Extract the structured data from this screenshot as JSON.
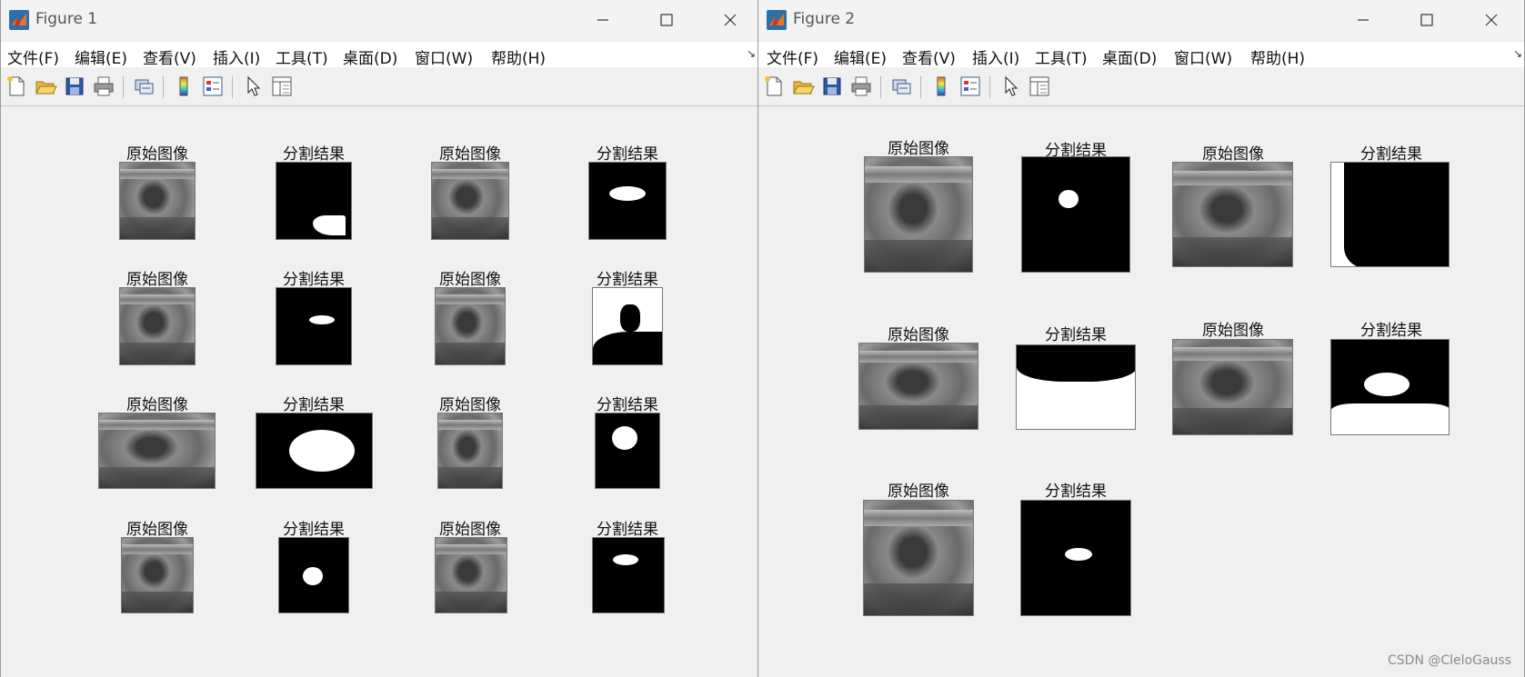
{
  "window1": {
    "title": "Figure 1",
    "menu": [
      "文件(F)",
      "编辑(E)",
      "查看(V)",
      "插入(I)",
      "工具(T)",
      "桌面(D)",
      "窗口(W)",
      "帮助(H)"
    ],
    "panels": [
      "原始图像",
      "分割结果",
      "原始图像",
      "分割结果",
      "原始图像",
      "分割结果",
      "原始图像",
      "分割结果",
      "原始图像",
      "分割结果",
      "原始图像",
      "分割结果",
      "原始图像",
      "分割结果",
      "原始图像",
      "分割结果"
    ]
  },
  "window2": {
    "title": "Figure 2",
    "menu": [
      "文件(F)",
      "编辑(E)",
      "查看(V)",
      "插入(I)",
      "工具(T)",
      "桌面(D)",
      "窗口(W)",
      "帮助(H)"
    ],
    "panels": [
      "原始图像",
      "分割结果",
      "原始图像",
      "分割结果",
      "原始图像",
      "分割结果",
      "原始图像",
      "分割结果",
      "原始图像",
      "分割结果"
    ]
  },
  "icons": {
    "toolbar": [
      "new-figure-icon",
      "open-file-icon",
      "save-icon",
      "print-icon",
      "link-plot-icon",
      "colorbar-icon",
      "legend-icon",
      "pointer-icon",
      "property-inspector-icon"
    ]
  },
  "watermark": "CSDN @CleloGauss"
}
